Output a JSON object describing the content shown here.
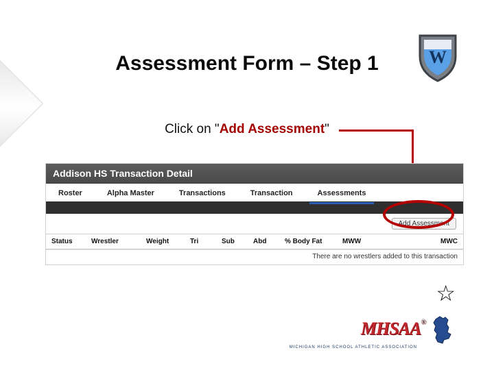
{
  "title": "Assessment Form – Step 1",
  "instruction": {
    "prefix": "Click on \"",
    "emphasis": "Add Assessment",
    "suffix": "\""
  },
  "screenshot": {
    "header": "Addison HS Transaction Detail",
    "nav": [
      "Roster",
      "Alpha Master",
      "Transactions",
      "Transaction",
      "Assessments"
    ],
    "active_nav_index": 4,
    "add_button_label": "Add Assessment",
    "columns": [
      "Status",
      "Wrestler",
      "Weight",
      "Tri",
      "Sub",
      "Abd",
      "% Body Fat",
      "MWW",
      "MWC"
    ],
    "empty_message": "There are no wrestlers added to this transaction"
  },
  "footer": {
    "logo_text": "MHSAA",
    "registered": "®",
    "subtitle": "MICHIGAN HIGH SCHOOL ATHLETIC ASSOCIATION"
  },
  "icons": {
    "star": "☆"
  },
  "colors": {
    "accent_red": "#b50000",
    "brand_red": "#c1272d",
    "tab_underline": "#2a5fb6"
  }
}
